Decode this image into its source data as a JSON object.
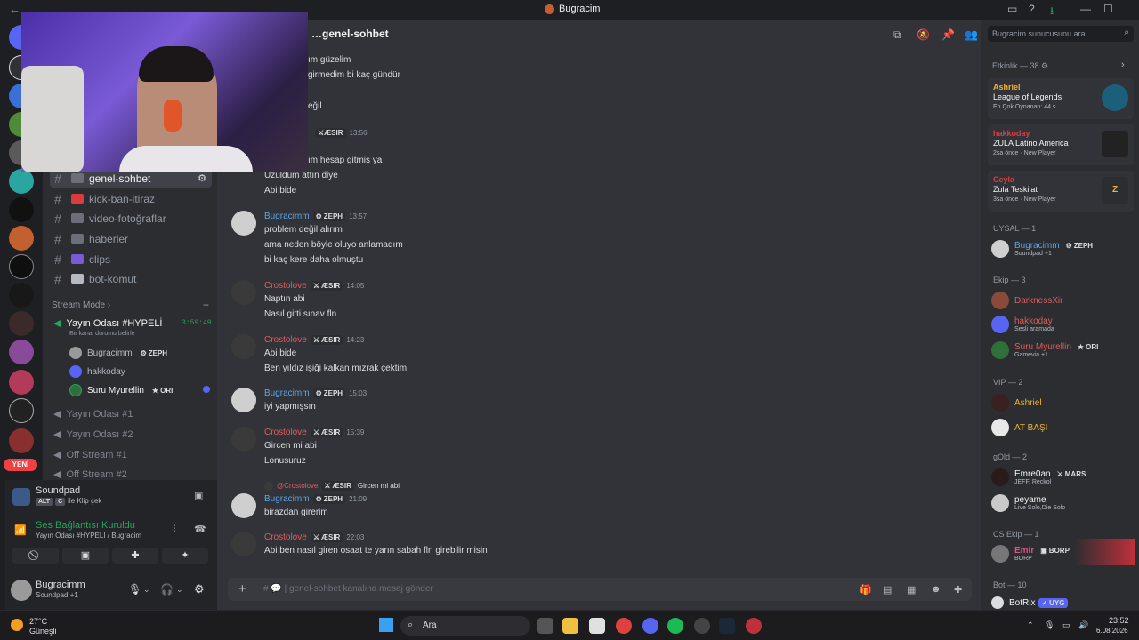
{
  "window": {
    "title": "Bugracim"
  },
  "sidebar": {
    "channels": [
      {
        "name": "genel-sohbet",
        "active": true
      },
      {
        "name": "kick-ban-itiraz"
      },
      {
        "name": "video-fotoğraflar"
      },
      {
        "name": "haberler"
      },
      {
        "name": "clips"
      },
      {
        "name": "bot-komut"
      }
    ],
    "stream_category": "Stream Mode",
    "live_channel": {
      "name": "Yayın Odası #HYPELİ",
      "timer": "3:59:49",
      "status": "Bir kanal durumu belirle"
    },
    "voice_users": [
      {
        "name": "Bugracimm",
        "badge": "ZEPH"
      },
      {
        "name": "hakkoday",
        "badge": ""
      },
      {
        "name": "Suru Myurellin",
        "badge": "ORI"
      }
    ],
    "voice_channels": [
      "Yayın Odası #1",
      "Yayın Odası #2",
      "Off Stream #1",
      "Off Stream #2"
    ],
    "new_label": "YENİ"
  },
  "panel": {
    "soundpad_title": "Soundpad",
    "soundpad_keys": [
      "ALT",
      "C"
    ],
    "soundpad_hint": "ile Klip çek",
    "voice_status": "Ses Bağlantısı Kuruldu",
    "voice_location": "Yayın Odası #HYPELİ / Bugracim",
    "user_name": "Bugracimm",
    "user_status": "Soundpad +1"
  },
  "chat": {
    "channel_title": "genel-sohbet",
    "partial_lines": [
      "ım güzelim",
      "girmedim bi kaç gündür",
      "eğil"
    ],
    "partial_time": "13:56",
    "partial_lines2": [
      "ım hesap gitmiş ya",
      "Üzüldüm attın diye",
      "Abi bide"
    ],
    "messages": [
      {
        "author": "Bugracimm",
        "badge": "ZEPH",
        "time": "13:57",
        "lines": [
          "problem değil alırım",
          "ama neden böyle oluyo anlamadım",
          "bi kaç kere daha olmuştu"
        ]
      },
      {
        "author": "Crostolove",
        "badge": "ÆSIR",
        "time": "14:05",
        "lines": [
          "Naptın abi",
          "Nasıl gitti sınav fln"
        ]
      },
      {
        "author": "Crostolove",
        "badge": "ÆSIR",
        "time": "14:23",
        "lines": [
          "Abi bide",
          "Ben yıldız işiği kalkan mızrak çektim"
        ]
      },
      {
        "author": "Bugracimm",
        "badge": "ZEPH",
        "time": "15:03",
        "lines": [
          "iyi yapmışsın"
        ]
      },
      {
        "author": "Crostolove",
        "badge": "ÆSIR",
        "time": "15:39",
        "lines": [
          "Gircen mi abi",
          "Lonusuruz"
        ]
      },
      {
        "author": "Bugracimm",
        "badge": "ZEPH",
        "time": "21:09",
        "lines": [
          "birazdan girerim"
        ]
      },
      {
        "author": "Crostolove",
        "badge": "ÆSIR",
        "time": "22:03",
        "lines": [
          "Abi ben nasıl giren osaat te yarın sabah fln girebilir misin"
        ]
      }
    ],
    "reply": {
      "author": "@Crostolove",
      "badge": "ÆSIR",
      "text": "Gircen mi abi"
    },
    "composer_placeholder": "genel-sohbet kanalına mesaj gönder"
  },
  "members": {
    "search_placeholder": "Bugracim sunucusunu ara",
    "activity_header": "Etkinlik — 38",
    "activities": [
      {
        "user": "Ashriel",
        "game": "League of Legends",
        "sub": "En Çok Oynanan: 44 s"
      },
      {
        "user": "hakkoday",
        "game": "ZULA Latino America",
        "sub": "2sa önce",
        "sub2": "New Player"
      },
      {
        "user": "Ceyla",
        "game": "Zula Teskilat",
        "sub": "3sa önce",
        "sub2": "New Player"
      }
    ],
    "roles": [
      {
        "header": "UYSAL — 1",
        "members": [
          {
            "name": "Bugracimm",
            "badge": "ZEPH",
            "sub": "Soundpad +1"
          }
        ]
      },
      {
        "header": "Ekip — 3",
        "members": [
          {
            "name": "DarknessXir",
            "sub": ""
          },
          {
            "name": "hakkoday",
            "sub": "Sesli aramada"
          },
          {
            "name": "Suru Myurellin",
            "badge": "ORI",
            "sub": "Gamevia +1"
          }
        ]
      },
      {
        "header": "VIP — 2",
        "members": [
          {
            "name": "Ashriel",
            "sub": ""
          },
          {
            "name": "AT BAŞI",
            "sub": ""
          }
        ]
      },
      {
        "header": "gOld — 2",
        "members": [
          {
            "name": "Emre0an",
            "badge": "MARS",
            "sub": "JEFF, Reckol"
          },
          {
            "name": "peyame",
            "sub": "Live Solo,Die Solo"
          }
        ]
      },
      {
        "header": "CS Ekip — 1",
        "members": [
          {
            "name": "Emir",
            "badge": "BORP",
            "sub": "BORP"
          }
        ]
      },
      {
        "header": "Bot — 10",
        "members": [
          {
            "name": "BotRix",
            "badge": "UYG",
            "sub": ""
          }
        ]
      }
    ]
  },
  "taskbar": {
    "weather_temp": "27°C",
    "weather_desc": "Güneşli",
    "search_label": "Ara",
    "time": "23:52",
    "date": "6.08.2026"
  },
  "colors": {
    "accent_blue": "#5aa7e8",
    "accent_red": "#e05c5c",
    "online": "#23a55a"
  },
  "icons": [
    "back-arrow-icon",
    "inbox-icon",
    "help-icon",
    "download-icon",
    "minimize-icon",
    "maximize-icon",
    "thread-icon",
    "mute-icon",
    "pin-icon",
    "members-icon",
    "search-icon",
    "plus-icon",
    "gift-icon",
    "gif-icon",
    "sticker-icon",
    "emoji-icon",
    "apps-icon",
    "mic-icon",
    "headphones-icon",
    "settings-icon"
  ]
}
